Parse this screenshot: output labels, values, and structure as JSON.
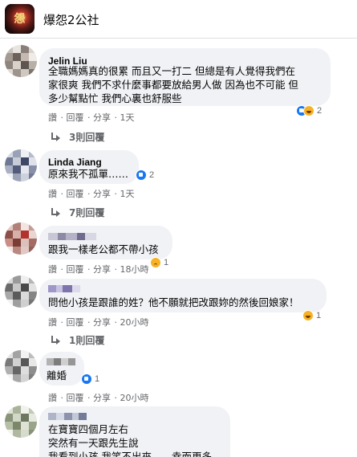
{
  "group": {
    "name": "爆怨2公社",
    "logo_text": "怨"
  },
  "colors": {
    "bubble": "#f0f2f5",
    "like": "#1877f2",
    "emoji": "#f7b125",
    "meta": "#65676b"
  },
  "comments": [
    {
      "author": "Jelin Liu",
      "lines": [
        "全職媽媽真的很累 而且又一打二 但總是有人覺得我們在",
        "家很爽 我們不求什麼事都要放給男人做 因為也不可能 但",
        "多少幫點忙 我們心裏也舒服些"
      ],
      "reactions": [
        "like",
        "haha"
      ],
      "reaction_count": "2",
      "actions": {
        "like": "讚",
        "reply": "回覆",
        "share": "分享",
        "time": "1天"
      },
      "replies": "3則回覆"
    },
    {
      "author": "Linda Jiang",
      "lines": [
        "原來我不孤單……"
      ],
      "reactions": [
        "like"
      ],
      "reaction_count": "2",
      "actions": {
        "like": "讚",
        "reply": "回覆",
        "share": "分享",
        "time": "1天"
      },
      "replies": "7則回覆"
    },
    {
      "author": "",
      "lines": [
        "跟我一樣老公都不帶小孩"
      ],
      "reactions": [
        "sad"
      ],
      "reaction_count": "1",
      "actions": {
        "like": "讚",
        "reply": "回覆",
        "share": "分享",
        "time": "18小時"
      },
      "replies": ""
    },
    {
      "author": "",
      "lines": [
        "問他小孩是跟誰的姓？他不願就把改跟妳的然後回娘家！"
      ],
      "reactions": [
        "haha"
      ],
      "reaction_count": "1",
      "actions": {
        "like": "讚",
        "reply": "回覆",
        "share": "分享",
        "time": "20小時"
      },
      "replies": "1則回覆"
    },
    {
      "author": "",
      "lines": [
        "離婚"
      ],
      "reactions": [
        "like"
      ],
      "reaction_count": "1",
      "actions": {
        "like": "讚",
        "reply": "回覆",
        "share": "分享",
        "time": "20小時"
      },
      "replies": ""
    },
    {
      "author": "",
      "lines": [
        "在寶寶四個月左右",
        "突然有一天跟先生說",
        "我看到小孩 我笑不出來……幸而更多"
      ],
      "reactions": [],
      "reaction_count": "",
      "actions": {},
      "replies": ""
    }
  ]
}
